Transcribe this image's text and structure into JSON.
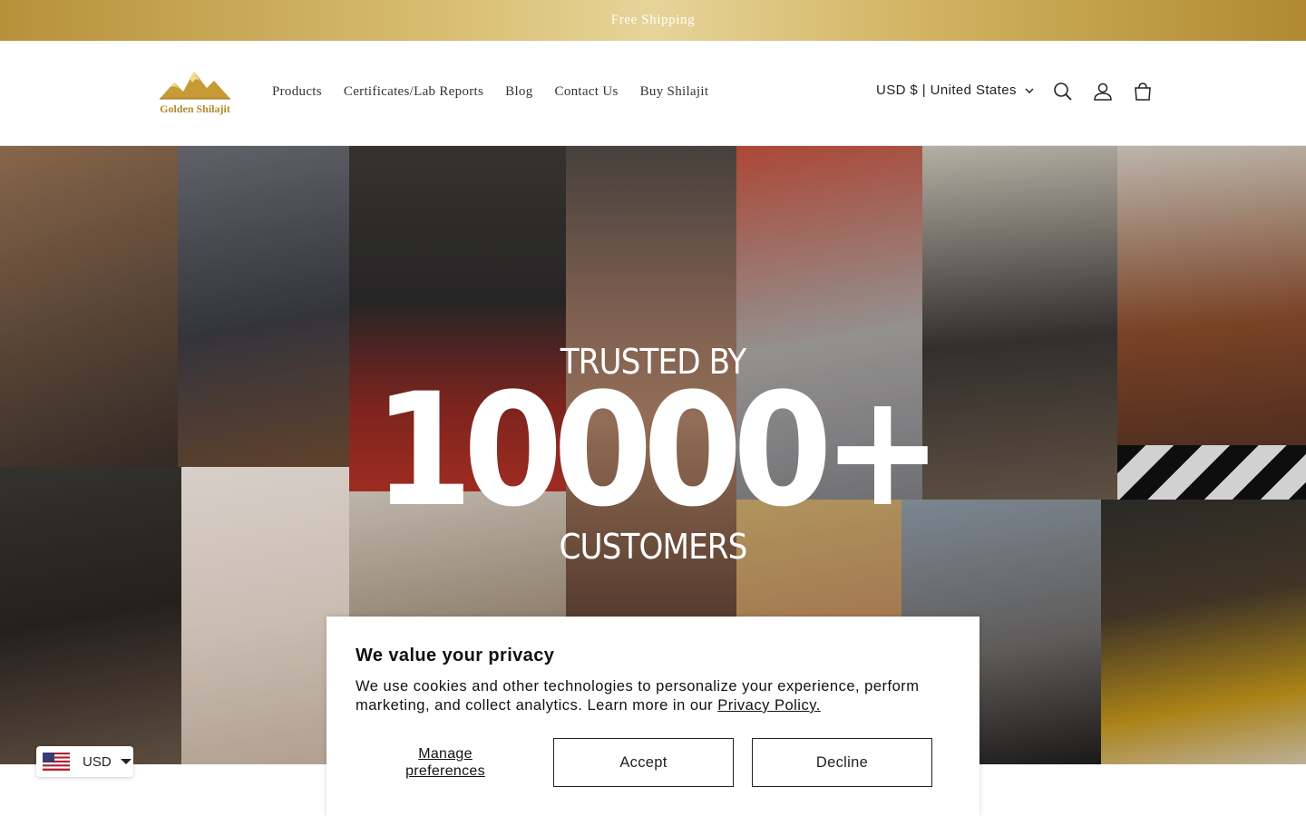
{
  "announcement": {
    "text": "Free Shipping"
  },
  "header": {
    "logo_text": "Golden Shilajit",
    "nav": [
      "Products",
      "Certificates/Lab Reports",
      "Blog",
      "Contact Us",
      "Buy Shilajit"
    ],
    "country": "USD $ | United States",
    "icons": [
      "search-icon",
      "account-icon",
      "cart-icon"
    ]
  },
  "hero": {
    "line1": "TRUSTED BY",
    "line2": "10000+",
    "line3": "CUSTOMERS"
  },
  "cookie": {
    "title": "We value your privacy",
    "body": "We use cookies and other technologies to personalize your experience, perform marketing, and collect analytics. Learn more in our ",
    "policy_link": "Privacy Policy.",
    "manage_label": "Manage preferences",
    "accept_label": "Accept",
    "decline_label": "Decline"
  },
  "currency_selector": {
    "value": "USD"
  },
  "colors": {
    "gold": "#c9a94f",
    "text": "#222222"
  }
}
